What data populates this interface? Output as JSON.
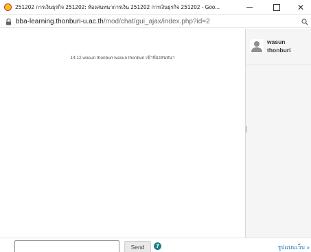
{
  "window": {
    "title": "251202 การเงินธุรกิจ 251202: ห้องสนทนาการเงิน 251202 การเงินธุรกิจ 251202 - Goo...",
    "minimize_icon": "minimize-icon",
    "maximize_icon": "maximize-icon",
    "close_label": "✕"
  },
  "address_bar": {
    "host": "bba-learning.thonburi-u.ac.th",
    "path": "/mod/chat/gui_ajax/index.php?id=2",
    "lock_icon": "lock-icon",
    "zoom_icon": "zoom-icon"
  },
  "chat": {
    "message": "14:12 wasun thonburi wasun thonburi เข้าห้องสนทนา"
  },
  "users": [
    {
      "name": "wasun thonburi",
      "avatar_icon": "user-avatar-icon"
    }
  ],
  "input": {
    "value": "",
    "send_label": "Send",
    "help_icon": "help-icon",
    "help_glyph": "?",
    "theme_link": "รูปแบบเว็บ »"
  },
  "colors": {
    "help_icon": "#1f7c8c",
    "link": "#1f6fb2",
    "userlist_bg": "#f5f5f5"
  }
}
